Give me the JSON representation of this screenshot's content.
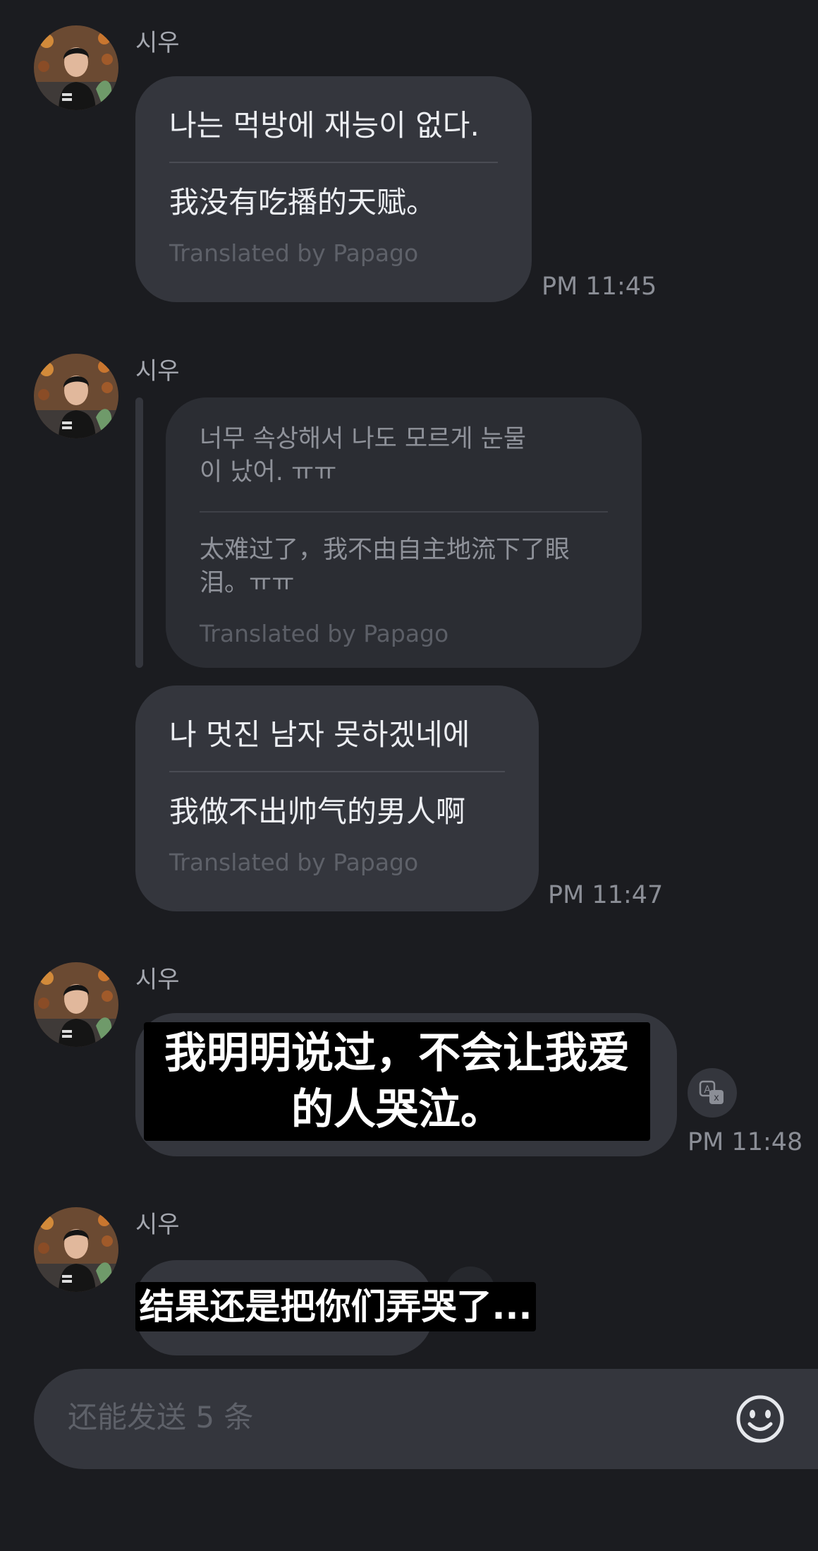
{
  "colors": {
    "background": "#1b1c20",
    "bubble": "#34363d",
    "quote_bubble": "#2b2d33",
    "text": "#eceef2",
    "muted": "#8b8e96"
  },
  "messages": [
    {
      "sender": "시우",
      "original": "나는 먹방에 재능이 없다.",
      "translated": "我没有吃播的天赋。",
      "credit": "Translated by Papago",
      "time": "PM 11:45"
    },
    {
      "sender": "시우",
      "quote": {
        "original_line1": "너무 속상해서 나도 모르게 눈물",
        "original_line2": "이 났어. ㅠㅠ",
        "translated_line1": "太难过了，我不由自主地流下了眼",
        "translated_line2": "泪。ㅠㅠ",
        "credit": "Translated by Papago"
      },
      "original": "나 멋진 남자 못하겠네에",
      "translated": "我做不出帅气的男人啊",
      "credit": "Translated by Papago",
      "time": "PM 11:47"
    },
    {
      "sender": "시우",
      "subtitle_line1": "我明明说过，不会让我爱",
      "subtitle_line2": "的人哭泣。",
      "translate_icon": "translate-icon",
      "time": "PM 11:48"
    },
    {
      "sender": "시우",
      "subtitle": "结果还是把你们弄哭了..."
    }
  ],
  "composer": {
    "placeholder": "还能发送 5 条",
    "emoji_icon": "smiley-icon"
  }
}
